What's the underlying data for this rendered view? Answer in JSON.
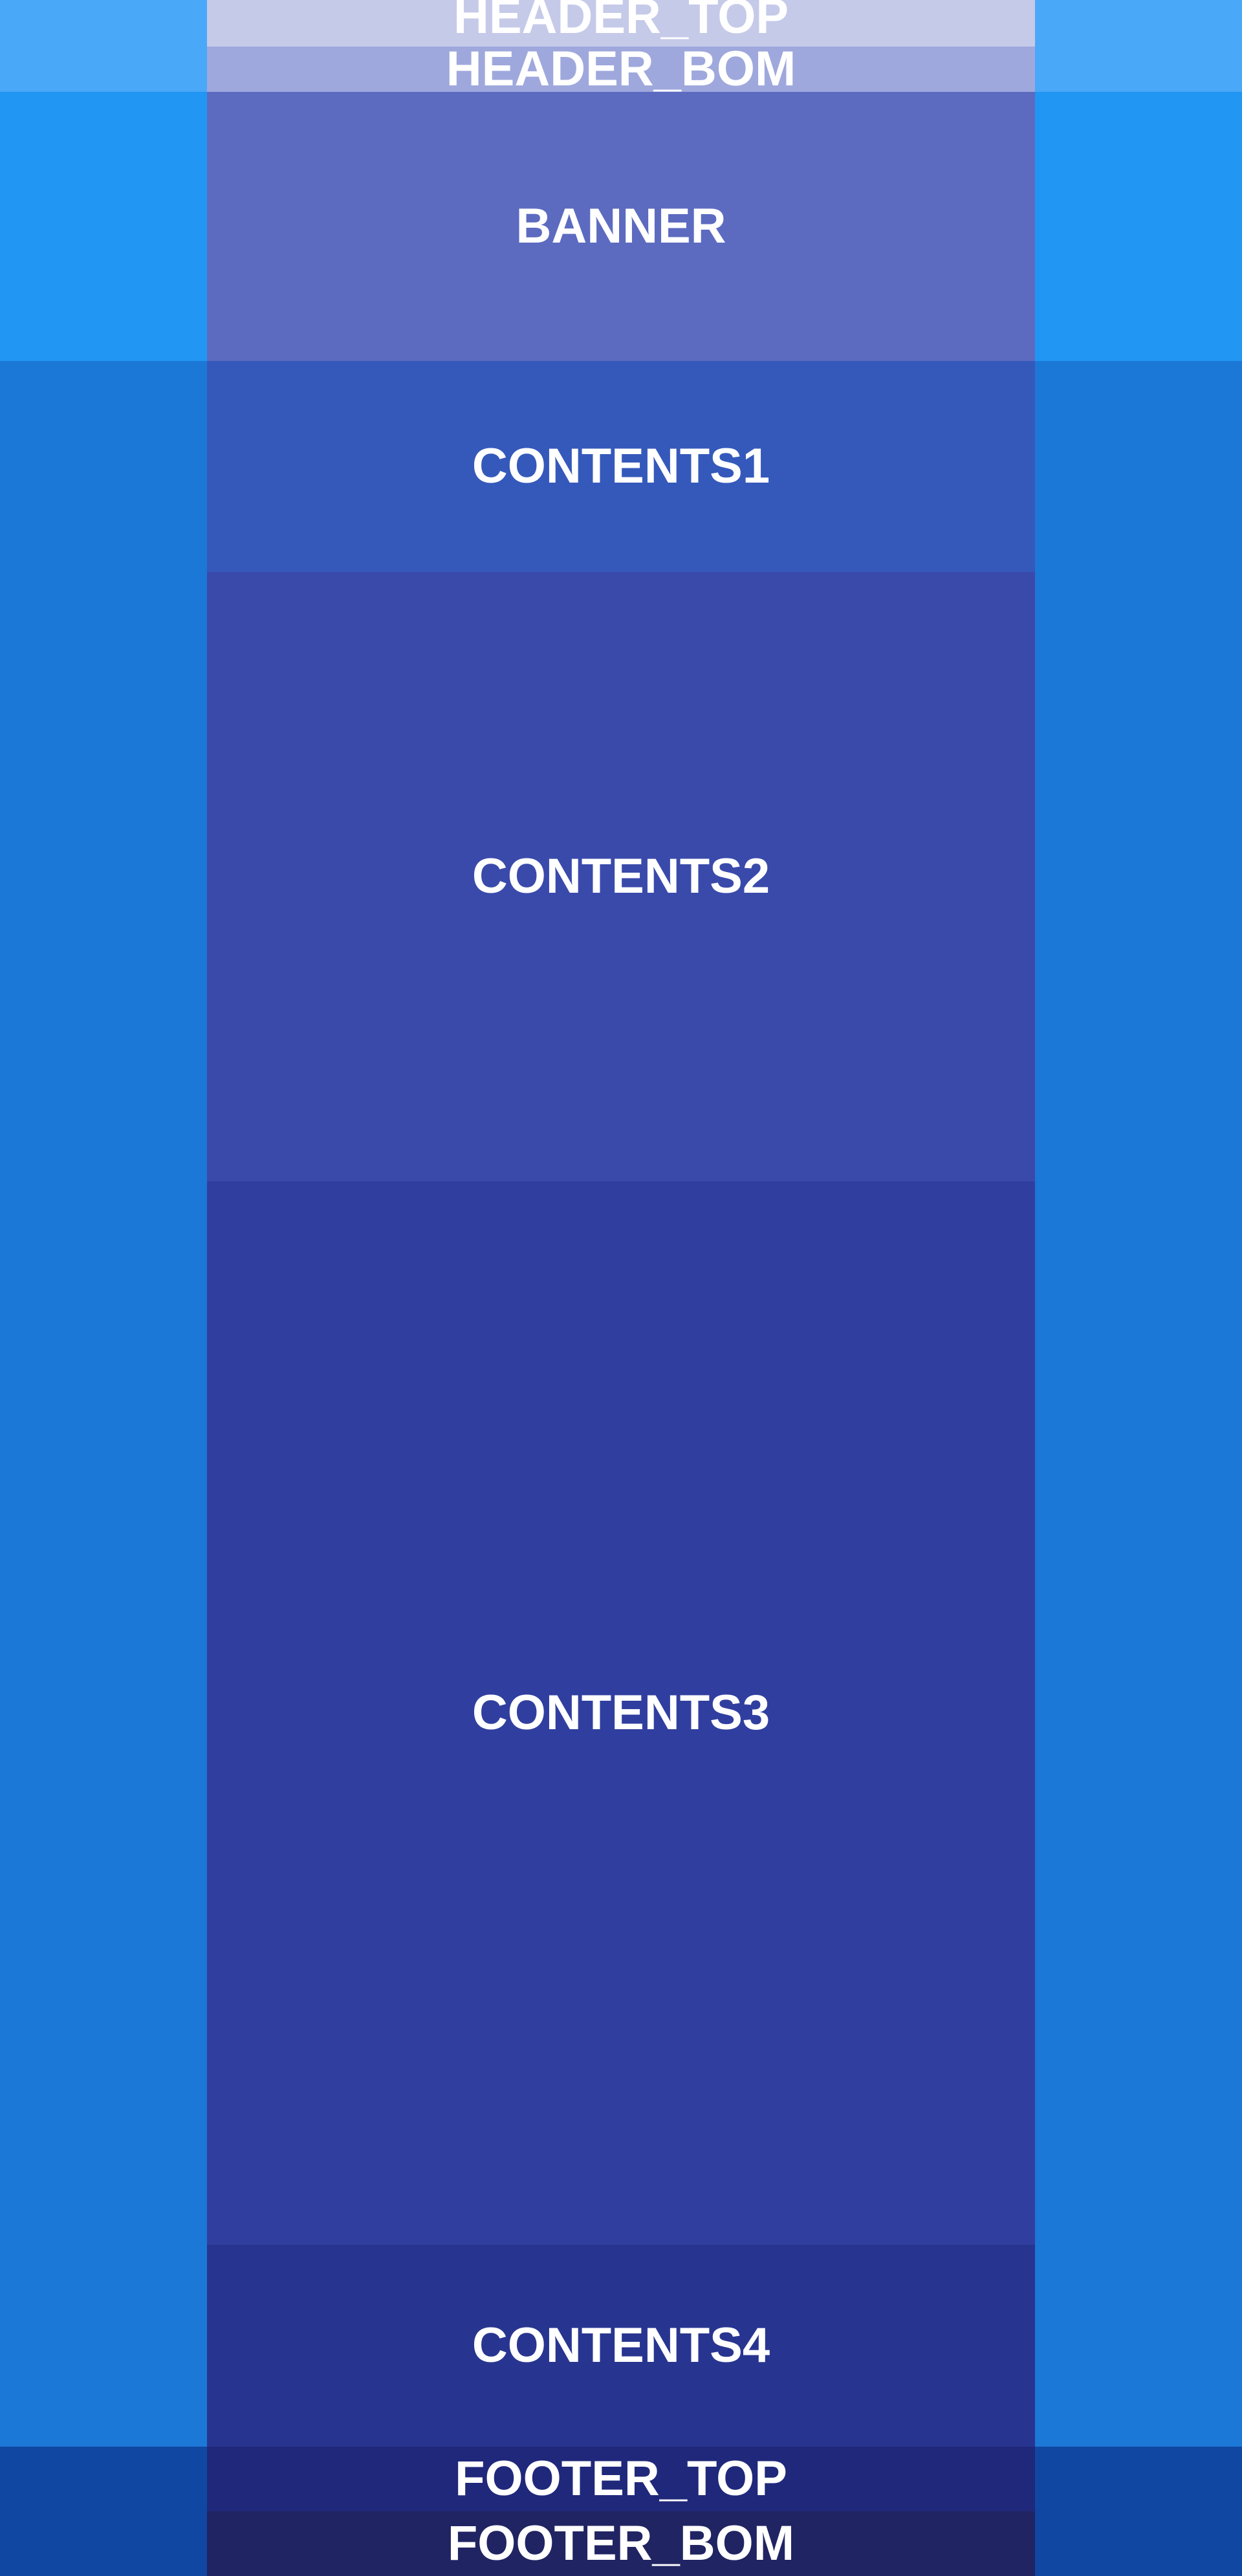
{
  "colors": {
    "header_band": "#4aa8f8",
    "banner_band": "#2196f3",
    "content_band": "#1c78d6",
    "footer_band": "#0f47a2",
    "header_top": "#c5cae9",
    "header_bom": "#9fa8dc",
    "banner": "#5c6bc0",
    "contents1": "#3559bb",
    "contents2": "#3a4aab",
    "contents3": "#303f9f",
    "contents4": "#283590",
    "footer_top": "#20287b",
    "footer_bom": "#212462"
  },
  "sections": {
    "header_top": "HEADER_TOP",
    "header_bom": "HEADER_BOM",
    "banner": "BANNER",
    "contents1": "CONTENTS1",
    "contents2": "CONTENTS2",
    "contents3": "CONTENTS3",
    "contents4": "CONTENTS4",
    "footer_top": "FOOTER_TOP",
    "footer_bom": "FOOTER_BOM"
  }
}
